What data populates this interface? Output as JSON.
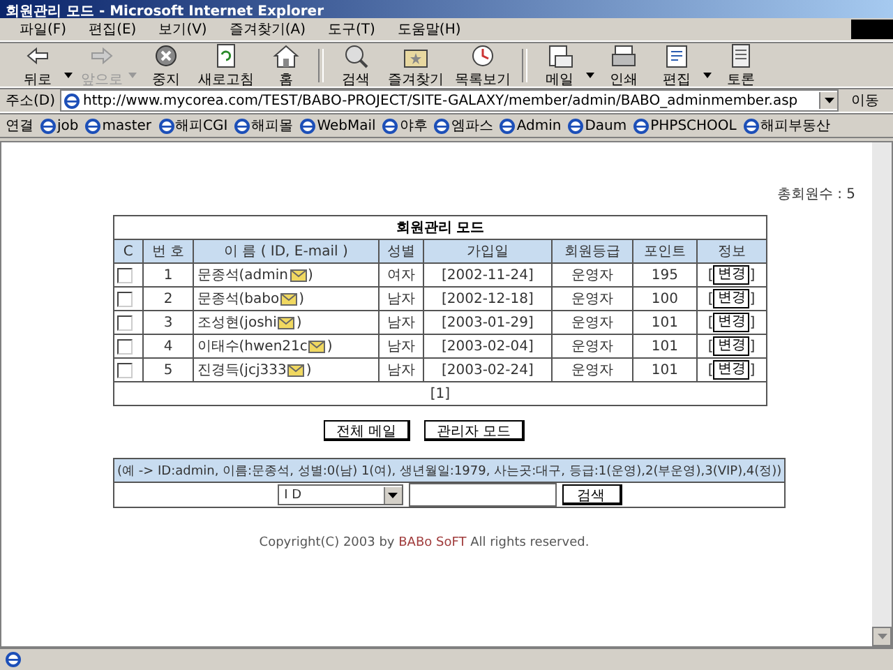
{
  "window": {
    "title": "회원관리 모드 - Microsoft Internet Explorer"
  },
  "menu": [
    "파일(F)",
    "편집(E)",
    "보기(V)",
    "즐겨찾기(A)",
    "도구(T)",
    "도움말(H)"
  ],
  "toolbar": [
    {
      "label": "뒤로",
      "kind": "back",
      "disabled": false,
      "dropdown": true
    },
    {
      "label": "앞으로",
      "kind": "forward",
      "disabled": true,
      "dropdown": true
    },
    {
      "label": "중지",
      "kind": "stop",
      "disabled": false,
      "dropdown": false
    },
    {
      "label": "새로고침",
      "kind": "refresh",
      "disabled": false,
      "dropdown": false
    },
    {
      "label": "홈",
      "kind": "home",
      "disabled": false,
      "dropdown": false
    },
    {
      "label": "검색",
      "kind": "search",
      "disabled": false,
      "dropdown": false
    },
    {
      "label": "즐겨찾기",
      "kind": "favorites",
      "disabled": false,
      "dropdown": false
    },
    {
      "label": "목록보기",
      "kind": "history",
      "disabled": false,
      "dropdown": false
    },
    {
      "label": "메일",
      "kind": "mail",
      "disabled": false,
      "dropdown": true
    },
    {
      "label": "인쇄",
      "kind": "print",
      "disabled": false,
      "dropdown": false
    },
    {
      "label": "편집",
      "kind": "edit",
      "disabled": false,
      "dropdown": true
    },
    {
      "label": "토론",
      "kind": "discuss",
      "disabled": false,
      "dropdown": false
    }
  ],
  "address": {
    "label": "주소(D)",
    "value": "http://www.mycorea.com/TEST/BABO-PROJECT/SITE-GALAXY/member/admin/BABO_adminmember.asp",
    "go": "이동"
  },
  "links": {
    "label": "연결",
    "items": [
      "job",
      "master",
      "해피CGI",
      "해피몰",
      "WebMail",
      "야후",
      "엠파스",
      "Admin",
      "Daum",
      "PHPSCHOOL",
      "해피부동산"
    ]
  },
  "page": {
    "total": "총회원수 : 5",
    "table": {
      "title": "회원관리 모드",
      "columns": [
        "C",
        "번 호",
        "이 름 ( ID, E-mail )",
        "성별",
        "가입일",
        "회원등급",
        "포인트",
        "정보"
      ],
      "rows": [
        {
          "checked": false,
          "no": "1",
          "name": "문종석(admin",
          "name_end": ")",
          "gender": "여자",
          "joined": "[2002-11-24]",
          "grade": "운영자",
          "points": "195",
          "info": [
            "[",
            "변경",
            "]"
          ]
        },
        {
          "checked": false,
          "no": "2",
          "name": "문종석(babo",
          "name_end": ")",
          "gender": "남자",
          "joined": "[2002-12-18]",
          "grade": "운영자",
          "points": "100",
          "info": [
            "[",
            "변경",
            "]"
          ]
        },
        {
          "checked": false,
          "no": "3",
          "name": "조성현(joshi",
          "name_end": ")",
          "gender": "남자",
          "joined": "[2003-01-29]",
          "grade": "운영자",
          "points": "101",
          "info": [
            "[",
            "변경",
            "]"
          ]
        },
        {
          "checked": false,
          "no": "4",
          "name": "이태수(hwen21c",
          "name_end": ")",
          "gender": "남자",
          "joined": "[2003-02-04]",
          "grade": "운영자",
          "points": "101",
          "info": [
            "[",
            "변경",
            "]"
          ]
        },
        {
          "checked": false,
          "no": "5",
          "name": "진경득(jcj333",
          "name_end": ")",
          "gender": "남자",
          "joined": "[2003-02-24]",
          "grade": "운영자",
          "points": "101",
          "info": [
            "[",
            "변경",
            "]"
          ]
        }
      ],
      "pagination": "[1]"
    },
    "buttons": [
      "전체 메일",
      "관리자 모드"
    ],
    "search": {
      "hint": "(예 -> ID:admin, 이름:문종석, 성별:0(남) 1(여), 생년월일:1979, 사는곳:대구, 등급:1(운영),2(부운영),3(VIP),4(정))",
      "field": "I D",
      "button": "검색"
    },
    "copyright": [
      "Copyright(C) 2003 by ",
      "BABo SoFT",
      " All rights reserved."
    ]
  }
}
